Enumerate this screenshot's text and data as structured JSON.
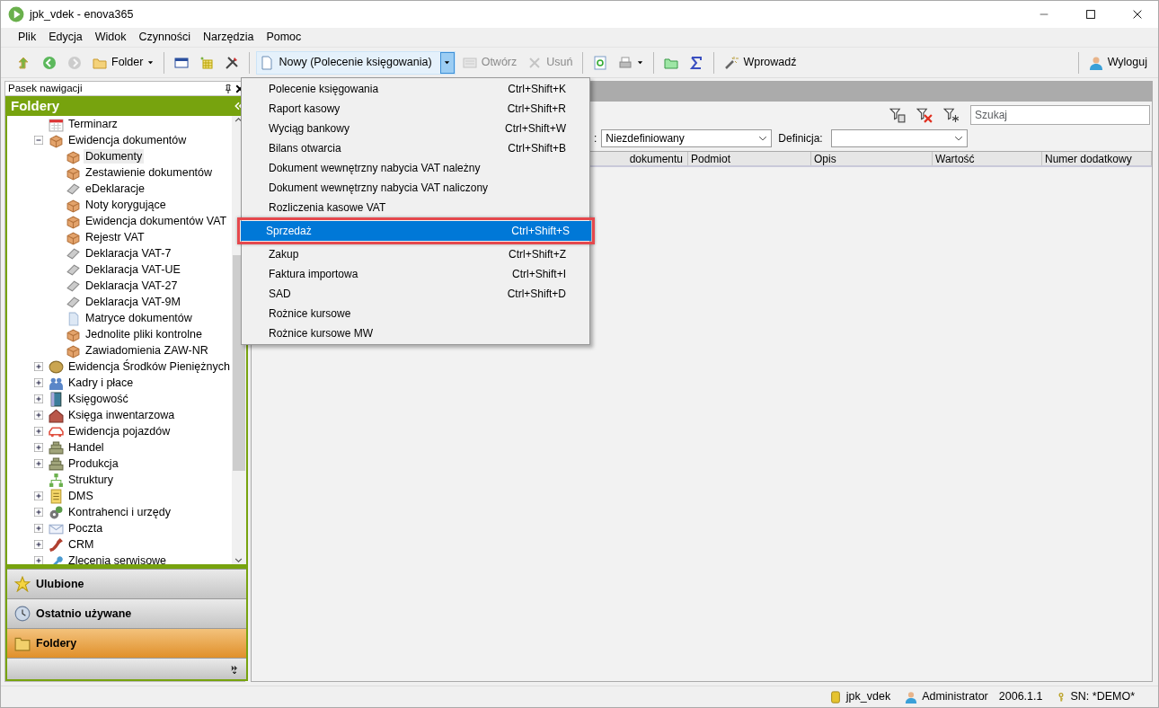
{
  "window": {
    "title": "jpk_vdek - enova365"
  },
  "menu": [
    "Plik",
    "Edycja",
    "Widok",
    "Czynności",
    "Narzędzia",
    "Pomoc"
  ],
  "toolbar": [
    {
      "kind": "up"
    },
    {
      "kind": "back"
    },
    {
      "kind": "forward",
      "disabled": true
    },
    {
      "kind": "folder",
      "label": "Folder"
    },
    {
      "kind": "sep"
    },
    {
      "kind": "panel"
    },
    {
      "kind": "grid"
    },
    {
      "kind": "tools"
    },
    {
      "kind": "sep"
    },
    {
      "kind": "new",
      "label": "Nowy (Polecenie księgowania)",
      "expanded": true
    },
    {
      "kind": "open",
      "label": "Otwórz",
      "disabled": true
    },
    {
      "kind": "delete",
      "label": "Usuń",
      "disabled": true
    },
    {
      "kind": "sep"
    },
    {
      "kind": "refresh"
    },
    {
      "kind": "print"
    },
    {
      "kind": "sep"
    },
    {
      "kind": "greenfolder"
    },
    {
      "kind": "sigma"
    },
    {
      "kind": "sep"
    },
    {
      "kind": "wand",
      "label": "Wprowadź"
    }
  ],
  "logout": "Wyloguj",
  "nav_pane": {
    "title": "Pasek nawigacji",
    "header": "Foldery",
    "tree": [
      {
        "label": "Terminarz",
        "kind": "calendar",
        "selected": false
      },
      {
        "label": "Ewidencja dokumentów",
        "kind": "box",
        "selected": false,
        "expanded": true,
        "children": [
          {
            "label": "Dokumenty",
            "kind": "box",
            "selected": true
          },
          {
            "label": "Zestawienie dokumentów",
            "kind": "box",
            "selected": false
          },
          {
            "label": "eDeklaracje",
            "kind": "sheet",
            "selected": false
          },
          {
            "label": "Noty korygujące",
            "kind": "box",
            "selected": false
          },
          {
            "label": "Ewidencja dokumentów VAT",
            "kind": "box",
            "selected": false
          },
          {
            "label": "Rejestr VAT",
            "kind": "box",
            "selected": false
          },
          {
            "label": "Deklaracja VAT-7",
            "kind": "sheet",
            "selected": false
          },
          {
            "label": "Deklaracja VAT-UE",
            "kind": "sheet",
            "selected": false
          },
          {
            "label": "Deklaracja VAT-27",
            "kind": "sheet",
            "selected": false
          },
          {
            "label": "Deklaracja VAT-9M",
            "kind": "sheet",
            "selected": false
          },
          {
            "label": "Matryce dokumentów",
            "kind": "page",
            "selected": false
          },
          {
            "label": "Jednolite pliki kontrolne",
            "kind": "box",
            "selected": false
          },
          {
            "label": "Zawiadomienia ZAW-NR",
            "kind": "box",
            "selected": false
          }
        ]
      },
      {
        "label": "Ewidencja Środków Pieniężnych",
        "kind": "coin",
        "selected": false,
        "expanded": false
      },
      {
        "label": "Kadry i płace",
        "kind": "people",
        "selected": false,
        "expanded": false
      },
      {
        "label": "Księgowość",
        "kind": "book",
        "selected": false,
        "expanded": false
      },
      {
        "label": "Księga inwentarzowa",
        "kind": "house",
        "selected": false,
        "expanded": false
      },
      {
        "label": "Ewidencja pojazdów",
        "kind": "car",
        "selected": false,
        "expanded": false
      },
      {
        "label": "Handel",
        "kind": "stack",
        "selected": false,
        "expanded": false
      },
      {
        "label": "Produkcja",
        "kind": "stack",
        "selected": false,
        "expanded": false
      },
      {
        "label": "Struktury",
        "kind": "org",
        "selected": false
      },
      {
        "label": "DMS",
        "kind": "doc",
        "selected": false,
        "expanded": false
      },
      {
        "label": "Kontrahenci i urzędy",
        "kind": "gears",
        "selected": false,
        "expanded": false
      },
      {
        "label": "Poczta",
        "kind": "mail",
        "selected": false,
        "expanded": false
      },
      {
        "label": "CRM",
        "kind": "phone",
        "selected": false,
        "expanded": false
      },
      {
        "label": "Zlecenia serwisowe",
        "kind": "wrench",
        "selected": false,
        "expanded": false
      }
    ],
    "sections": [
      {
        "label": "Ulubione",
        "kind": "star",
        "selected": false
      },
      {
        "label": "Ostatnio używane",
        "kind": "clock",
        "selected": false
      },
      {
        "label": "Foldery",
        "kind": "folder",
        "selected": true
      }
    ]
  },
  "filters": {
    "search_placeholder": "Szukaj",
    "label_1": ":",
    "combo_1": "Niezdefiniowany",
    "label_2": "Definicja:"
  },
  "table": {
    "columns": [
      "dokumentu",
      "Podmiot",
      "Opis",
      "Wartość",
      "Numer dodatkowy"
    ]
  },
  "dropdown": [
    {
      "label": "Polecenie księgowania",
      "shortcut": "Ctrl+Shift+K",
      "selected": false
    },
    {
      "label": "Raport kasowy",
      "shortcut": "Ctrl+Shift+R",
      "selected": false
    },
    {
      "label": "Wyciąg bankowy",
      "shortcut": "Ctrl+Shift+W",
      "selected": false
    },
    {
      "label": "Bilans otwarcia",
      "shortcut": "Ctrl+Shift+B",
      "selected": false
    },
    {
      "label": "Dokument wewnętrzny nabycia VAT należny",
      "selected": false
    },
    {
      "label": "Dokument wewnętrzny nabycia VAT naliczony",
      "selected": false
    },
    {
      "label": "Rozliczenia kasowe VAT",
      "selected": false
    },
    {
      "label": "Sprzedaż",
      "shortcut": "Ctrl+Shift+S",
      "selected": true,
      "annotated": true
    },
    {
      "label": "Zakup",
      "shortcut": "Ctrl+Shift+Z",
      "selected": false
    },
    {
      "label": "Faktura importowa",
      "shortcut": "Ctrl+Shift+I",
      "selected": false
    },
    {
      "label": "SAD",
      "shortcut": "Ctrl+Shift+D",
      "selected": false
    },
    {
      "label": "Rożnice kursowe",
      "selected": false
    },
    {
      "label": "Rożnice kursowe MW",
      "selected": false
    }
  ],
  "status_bar": {
    "database": "jpk_vdek",
    "user": "Administrator",
    "version": "2006.1.1",
    "serial": "SN: *DEMO*"
  }
}
